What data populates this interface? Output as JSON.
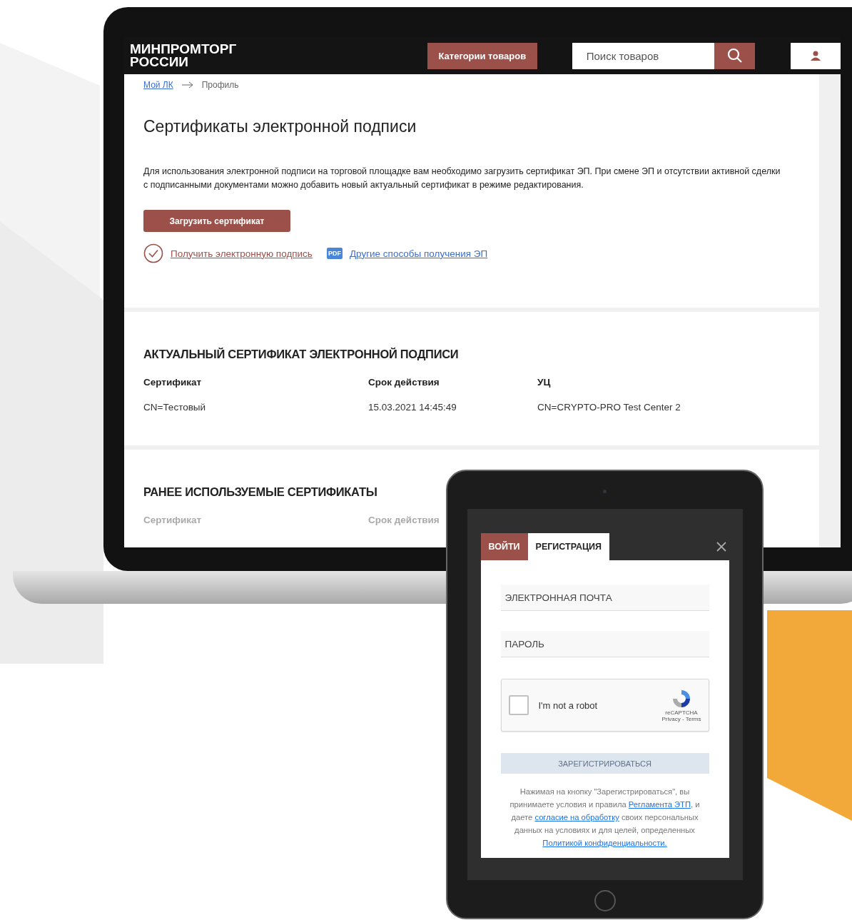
{
  "header": {
    "logo_lines": [
      "МИНПРОМТОРГ",
      "РОССИИ"
    ],
    "categories_button": "Категории товаров",
    "search": {
      "placeholder": "Поиск товаров"
    }
  },
  "breadcrumbs": [
    {
      "label": "Мой ЛК",
      "link": true
    },
    {
      "label": "Профиль",
      "link": false
    }
  ],
  "title": "Сертификаты электронной подписи",
  "description": "Для использования электронной подписи на торговой площадке вам необходимо загрузить сертификат ЭП. При смене ЭП и отсутствии активной сделки с подписанными документами можно добавить новый актуальный сертификат в режиме редактирования.",
  "upload_button": "Загрузить сертификат",
  "links": [
    {
      "kind": "check",
      "label": "Получить электронную подпись"
    },
    {
      "kind": "pdf",
      "label": "Другие способы получения ЭП",
      "icon_text": "PDF"
    }
  ],
  "current": {
    "title": "АКТУАЛЬНЫЙ СЕРТИФИКАТ ЭЛЕКТРОННОЙ ПОДПИСИ",
    "columns": [
      "Сертификат",
      "Срок действия",
      "УЦ"
    ],
    "row": [
      "CN=Тестовый",
      "15.03.2021 14:45:49",
      "CN=CRYPTO-PRO Test Center 2"
    ]
  },
  "previous": {
    "title": "РАНЕЕ ИСПОЛЬЗУЕМЫЕ СЕРТИФИКАТЫ",
    "columns": [
      "Сертификат",
      "Срок действия"
    ]
  },
  "modal": {
    "tabs": [
      {
        "label": "ВОЙТИ",
        "selected": false
      },
      {
        "label": "РЕГИСТРАЦИЯ",
        "selected": true
      }
    ],
    "fields": [
      {
        "placeholder": "ЭЛЕКТРОННАЯ ПОЧТА"
      },
      {
        "placeholder": "ПАРОЛЬ"
      }
    ],
    "captcha": {
      "label": "I'm not a robot",
      "checked": false,
      "brand": "reCAPTCHA",
      "links": "Privacy - Terms"
    },
    "submit": {
      "label": "ЗАРЕГИСТРИРОВАТЬСЯ",
      "disabled": true
    },
    "consent": [
      {
        "text": "Нажимая на кнопку \"Зарегистрироваться\", вы принимаете условия и правила ",
        "link": false
      },
      {
        "text": "Регламента ЭТП",
        "link": true
      },
      {
        "text": ", и даете ",
        "link": false
      },
      {
        "text": "согласие на обработку",
        "link": true
      },
      {
        "text": " своих персональных данных на условиях и для целей, определенных ",
        "link": false
      },
      {
        "text": "Политикой конфиденциальности.",
        "link": true
      }
    ]
  }
}
